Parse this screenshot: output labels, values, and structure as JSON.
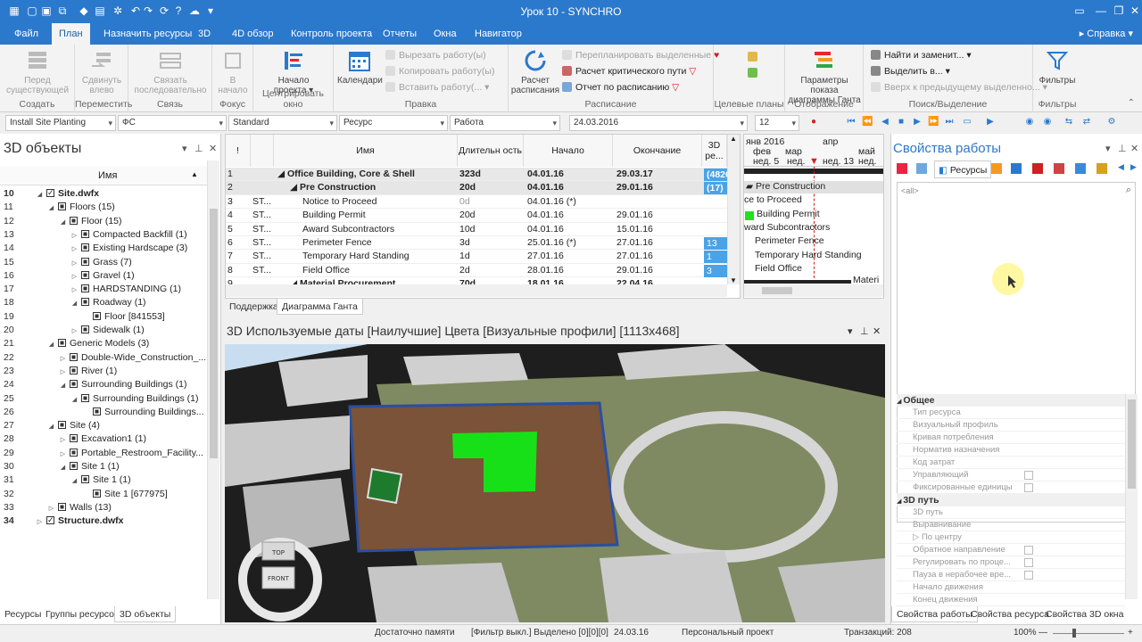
{
  "window": {
    "title": "Урок 10 - SYNCHRO"
  },
  "ribbon_tabs": [
    "Файл",
    "План",
    "Назначить ресурсы",
    "3D",
    "4D обзор",
    "Контроль проекта",
    "Отчеты",
    "Окна",
    "Навигатор"
  ],
  "help_label": "Справка",
  "ribbon": {
    "groups": [
      "Создать",
      "Переместить",
      "Связь",
      "Фокус",
      "Центрировать окно",
      "Правка",
      "Расписание",
      "Целевые планы",
      "Отображение",
      "Поиск/Выделение",
      "Фильтры"
    ],
    "create_btn": "Перед существующей",
    "move_btn": "Сдвинуть влево",
    "link_btn": "Связать последовательно",
    "focus_btn": "В начало",
    "center_btn": "Начало проекта",
    "calendars_btn": "Календари",
    "edit_cut": "Вырезать работу(ы)",
    "edit_copy": "Копировать работу(ы)",
    "edit_paste": "Вставить работу(...",
    "schedule_btn": "Расчет расписания",
    "replan": "Перепланировать выделенные",
    "critical": "Расчет критического пути",
    "report": "Отчет по расписанию",
    "display_btn": "Параметры показа диаграммы Ганта",
    "find_replace": "Найти и заменит...",
    "select_in": "Выделить в...",
    "up_prev": "Вверх к предыдущему выделенно...",
    "filters_btn": "Фильтры"
  },
  "filterbar": {
    "combo1": "Install Site Planting",
    "combo2": "ФС",
    "combo3": "Standard",
    "combo4": "Ресурс",
    "combo5": "Работа",
    "date": "24.03.2016",
    "spin": "12"
  },
  "left_pane": {
    "title": "3D объекты",
    "col_name": "Имя",
    "rows": [
      {
        "n": "10",
        "label": "Site.dwfx",
        "lvl": 0,
        "exp": "◢",
        "cb": "check",
        "bold": true
      },
      {
        "n": "11",
        "label": "Floors (15)",
        "lvl": 1,
        "exp": "◢",
        "cb": "fill"
      },
      {
        "n": "12",
        "label": "Floor (15)",
        "lvl": 2,
        "exp": "◢",
        "cb": "fill"
      },
      {
        "n": "13",
        "label": "Compacted Backfill (1)",
        "lvl": 3,
        "exp": "▷",
        "cb": "fill"
      },
      {
        "n": "14",
        "label": "Existing Hardscape (3)",
        "lvl": 3,
        "exp": "▷",
        "cb": "fill"
      },
      {
        "n": "15",
        "label": "Grass (7)",
        "lvl": 3,
        "exp": "▷",
        "cb": "fill"
      },
      {
        "n": "16",
        "label": "Gravel (1)",
        "lvl": 3,
        "exp": "▷",
        "cb": "fill"
      },
      {
        "n": "17",
        "label": "HARDSTANDING (1)",
        "lvl": 3,
        "exp": "▷",
        "cb": "fill"
      },
      {
        "n": "18",
        "label": "Roadway (1)",
        "lvl": 3,
        "exp": "◢",
        "cb": "fill"
      },
      {
        "n": "19",
        "label": "Floor [841553]",
        "lvl": 4,
        "exp": "",
        "cb": "fill"
      },
      {
        "n": "20",
        "label": "Sidewalk (1)",
        "lvl": 3,
        "exp": "▷",
        "cb": "fill"
      },
      {
        "n": "21",
        "label": "Generic Models (3)",
        "lvl": 1,
        "exp": "◢",
        "cb": "fill"
      },
      {
        "n": "22",
        "label": "Double-Wide_Construction_...",
        "lvl": 2,
        "exp": "▷",
        "cb": "fill"
      },
      {
        "n": "23",
        "label": "River (1)",
        "lvl": 2,
        "exp": "▷",
        "cb": "fill"
      },
      {
        "n": "24",
        "label": "Surrounding Buildings (1)",
        "lvl": 2,
        "exp": "◢",
        "cb": "fill"
      },
      {
        "n": "25",
        "label": "Surrounding Buildings (1)",
        "lvl": 3,
        "exp": "◢",
        "cb": "fill"
      },
      {
        "n": "26",
        "label": "Surrounding Buildings...",
        "lvl": 4,
        "exp": "",
        "cb": "fill"
      },
      {
        "n": "27",
        "label": "Site (4)",
        "lvl": 1,
        "exp": "◢",
        "cb": "fill"
      },
      {
        "n": "28",
        "label": "Excavation1 (1)",
        "lvl": 2,
        "exp": "▷",
        "cb": "fill"
      },
      {
        "n": "29",
        "label": "Portable_Restroom_Facility...",
        "lvl": 2,
        "exp": "▷",
        "cb": "fill"
      },
      {
        "n": "30",
        "label": "Site 1 (1)",
        "lvl": 2,
        "exp": "◢",
        "cb": "fill"
      },
      {
        "n": "31",
        "label": "Site 1 (1)",
        "lvl": 3,
        "exp": "◢",
        "cb": "fill"
      },
      {
        "n": "32",
        "label": "Site 1 [677975]",
        "lvl": 4,
        "exp": "",
        "cb": "fill"
      },
      {
        "n": "33",
        "label": "Walls (13)",
        "lvl": 1,
        "exp": "▷",
        "cb": "fill"
      },
      {
        "n": "34",
        "label": "Structure.dwfx",
        "lvl": 0,
        "exp": "▷",
        "cb": "check",
        "bold": true
      }
    ],
    "bottom_tabs": [
      "Ресурсы",
      "Группы ресурсов",
      "3D объекты"
    ]
  },
  "grid": {
    "headers": {
      "flag": "!",
      "name": "Имя",
      "dur": "Длительн ость",
      "start": "Начало",
      "end": "Окончание",
      "res": "3D ре..."
    },
    "rows": [
      {
        "n": "1",
        "code": "",
        "name": "◢ Office Building, Core & Shell",
        "ind": 0,
        "dur": "323d",
        "start": "04.01.16",
        "end": "29.03.17",
        "res": "(4826",
        "bold": true
      },
      {
        "n": "2",
        "code": "",
        "name": "◢ Pre Construction",
        "ind": 1,
        "dur": "20d",
        "start": "04.01.16",
        "end": "29.01.16",
        "res": "(17)",
        "bold": true
      },
      {
        "n": "3",
        "code": "ST...",
        "name": "Notice to Proceed",
        "ind": 2,
        "dur": "0d",
        "start": "04.01.16 (*)",
        "end": "",
        "res": ""
      },
      {
        "n": "4",
        "code": "ST...",
        "name": "Building Permit",
        "ind": 2,
        "dur": "20d",
        "start": "04.01.16",
        "end": "29.01.16",
        "res": ""
      },
      {
        "n": "5",
        "code": "ST...",
        "name": "Award Subcontractors",
        "ind": 2,
        "dur": "10d",
        "start": "04.01.16",
        "end": "15.01.16",
        "res": ""
      },
      {
        "n": "6",
        "code": "ST...",
        "name": "Perimeter Fence",
        "ind": 2,
        "dur": "3d",
        "start": "25.01.16 (*)",
        "end": "27.01.16",
        "res": "13"
      },
      {
        "n": "7",
        "code": "ST...",
        "name": "Temporary Hard Standing",
        "ind": 2,
        "dur": "1d",
        "start": "27.01.16",
        "end": "27.01.16",
        "res": "1"
      },
      {
        "n": "8",
        "code": "ST...",
        "name": "Field Office",
        "ind": 2,
        "dur": "2d",
        "start": "28.01.16",
        "end": "29.01.16",
        "res": "3"
      },
      {
        "n": "9",
        "code": "",
        "name": "◢ Material Procurement",
        "ind": 1,
        "dur": "70d",
        "start": "18.01.16",
        "end": "22.04.16",
        "res": "",
        "bold": true
      }
    ]
  },
  "gantt": {
    "months": [
      "янв 2016",
      "мар",
      "апр",
      "май"
    ],
    "weeks": [
      "фев",
      "нед. 5",
      "нед.",
      "нед. 13",
      "нед."
    ],
    "bars": [
      "Pre Construction",
      "ce to Proceed",
      "Building Permit",
      "ward Subcontractors",
      "Perimeter Fence",
      "Temporary Hard Standing",
      "Field Office",
      "Materi"
    ]
  },
  "mid_tabs": [
    "Поддержка",
    "Диаграмма Ганта"
  ],
  "view3d": {
    "title": "3D Используемые даты [Наилучшие] Цвета [Визуальные профили]  [1113x468]",
    "cube_top": "TOP",
    "cube_front": "FRONT"
  },
  "right_pane": {
    "title": "Свойства работы",
    "res_tab": "Ресурсы",
    "search_placeholder": "<all>",
    "sections": [
      {
        "title": "Общее",
        "props": [
          {
            "label": "Тип ресурса",
            "chk": false
          },
          {
            "label": "Визуальный профиль",
            "chk": false
          },
          {
            "label": "Кривая потребления",
            "chk": false
          },
          {
            "label": "Норматив назначения",
            "chk": false
          },
          {
            "label": "Код затрат",
            "chk": false
          },
          {
            "label": "Управляющий",
            "chk": true
          },
          {
            "label": "Фиксированные единицы",
            "chk": true
          }
        ]
      },
      {
        "title": "3D путь",
        "props": [
          {
            "label": "3D путь",
            "chk": false
          },
          {
            "label": "Выравнивание",
            "chk": false
          },
          {
            "label": "▷ По центру",
            "chk": false
          },
          {
            "label": "Обратное направление",
            "chk": true
          },
          {
            "label": "Регулировать по проце...",
            "chk": true
          },
          {
            "label": "Пауза в нерабочее вре...",
            "chk": true
          },
          {
            "label": "Начало движения",
            "chk": false
          },
          {
            "label": "Конец движения",
            "chk": false
          }
        ]
      }
    ],
    "bottom_tabs": [
      "Свойства работы",
      "Свойства ресурса",
      "Свойства 3D окна"
    ]
  },
  "status": {
    "memory": "Достаточно памяти",
    "filter": "[Фильтр выкл.] Выделено [0][0][0]",
    "date": "24.03.16",
    "project": "Персональный проект",
    "transactions": "Транзакций: 208",
    "zoom": "100%"
  },
  "colors": {
    "accent": "#2b79cc",
    "badge": "#4aa3e6",
    "grass": "#8a9a6a",
    "soil": "#7d5638",
    "green": "#22e022"
  }
}
